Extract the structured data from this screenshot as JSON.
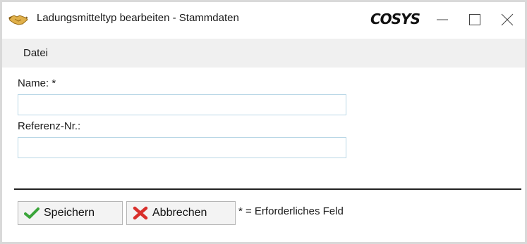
{
  "window": {
    "title": "Ladungsmitteltyp bearbeiten - Stammdaten",
    "brand": "COSYS",
    "app_icon": "handshake-icon",
    "controls": [
      "minimize-icon",
      "maximize-icon",
      "close-icon"
    ]
  },
  "menu": {
    "items": [
      {
        "label": "Datei"
      }
    ]
  },
  "form": {
    "name": {
      "label": "Name: *",
      "value": "",
      "placeholder": ""
    },
    "reference": {
      "label": "Referenz-Nr.:",
      "value": "",
      "placeholder": ""
    }
  },
  "footer": {
    "save_label": "Speichern",
    "save_icon": "checkmark-icon",
    "cancel_label": "Abbrechen",
    "cancel_icon": "cross-icon",
    "required_hint": "* = Erforderliches Feld"
  },
  "colors": {
    "field_border": "#b9d7e6",
    "menubar_bg": "#f0f0f0",
    "check_green": "#3aa53a",
    "cross_red": "#d9302c"
  }
}
